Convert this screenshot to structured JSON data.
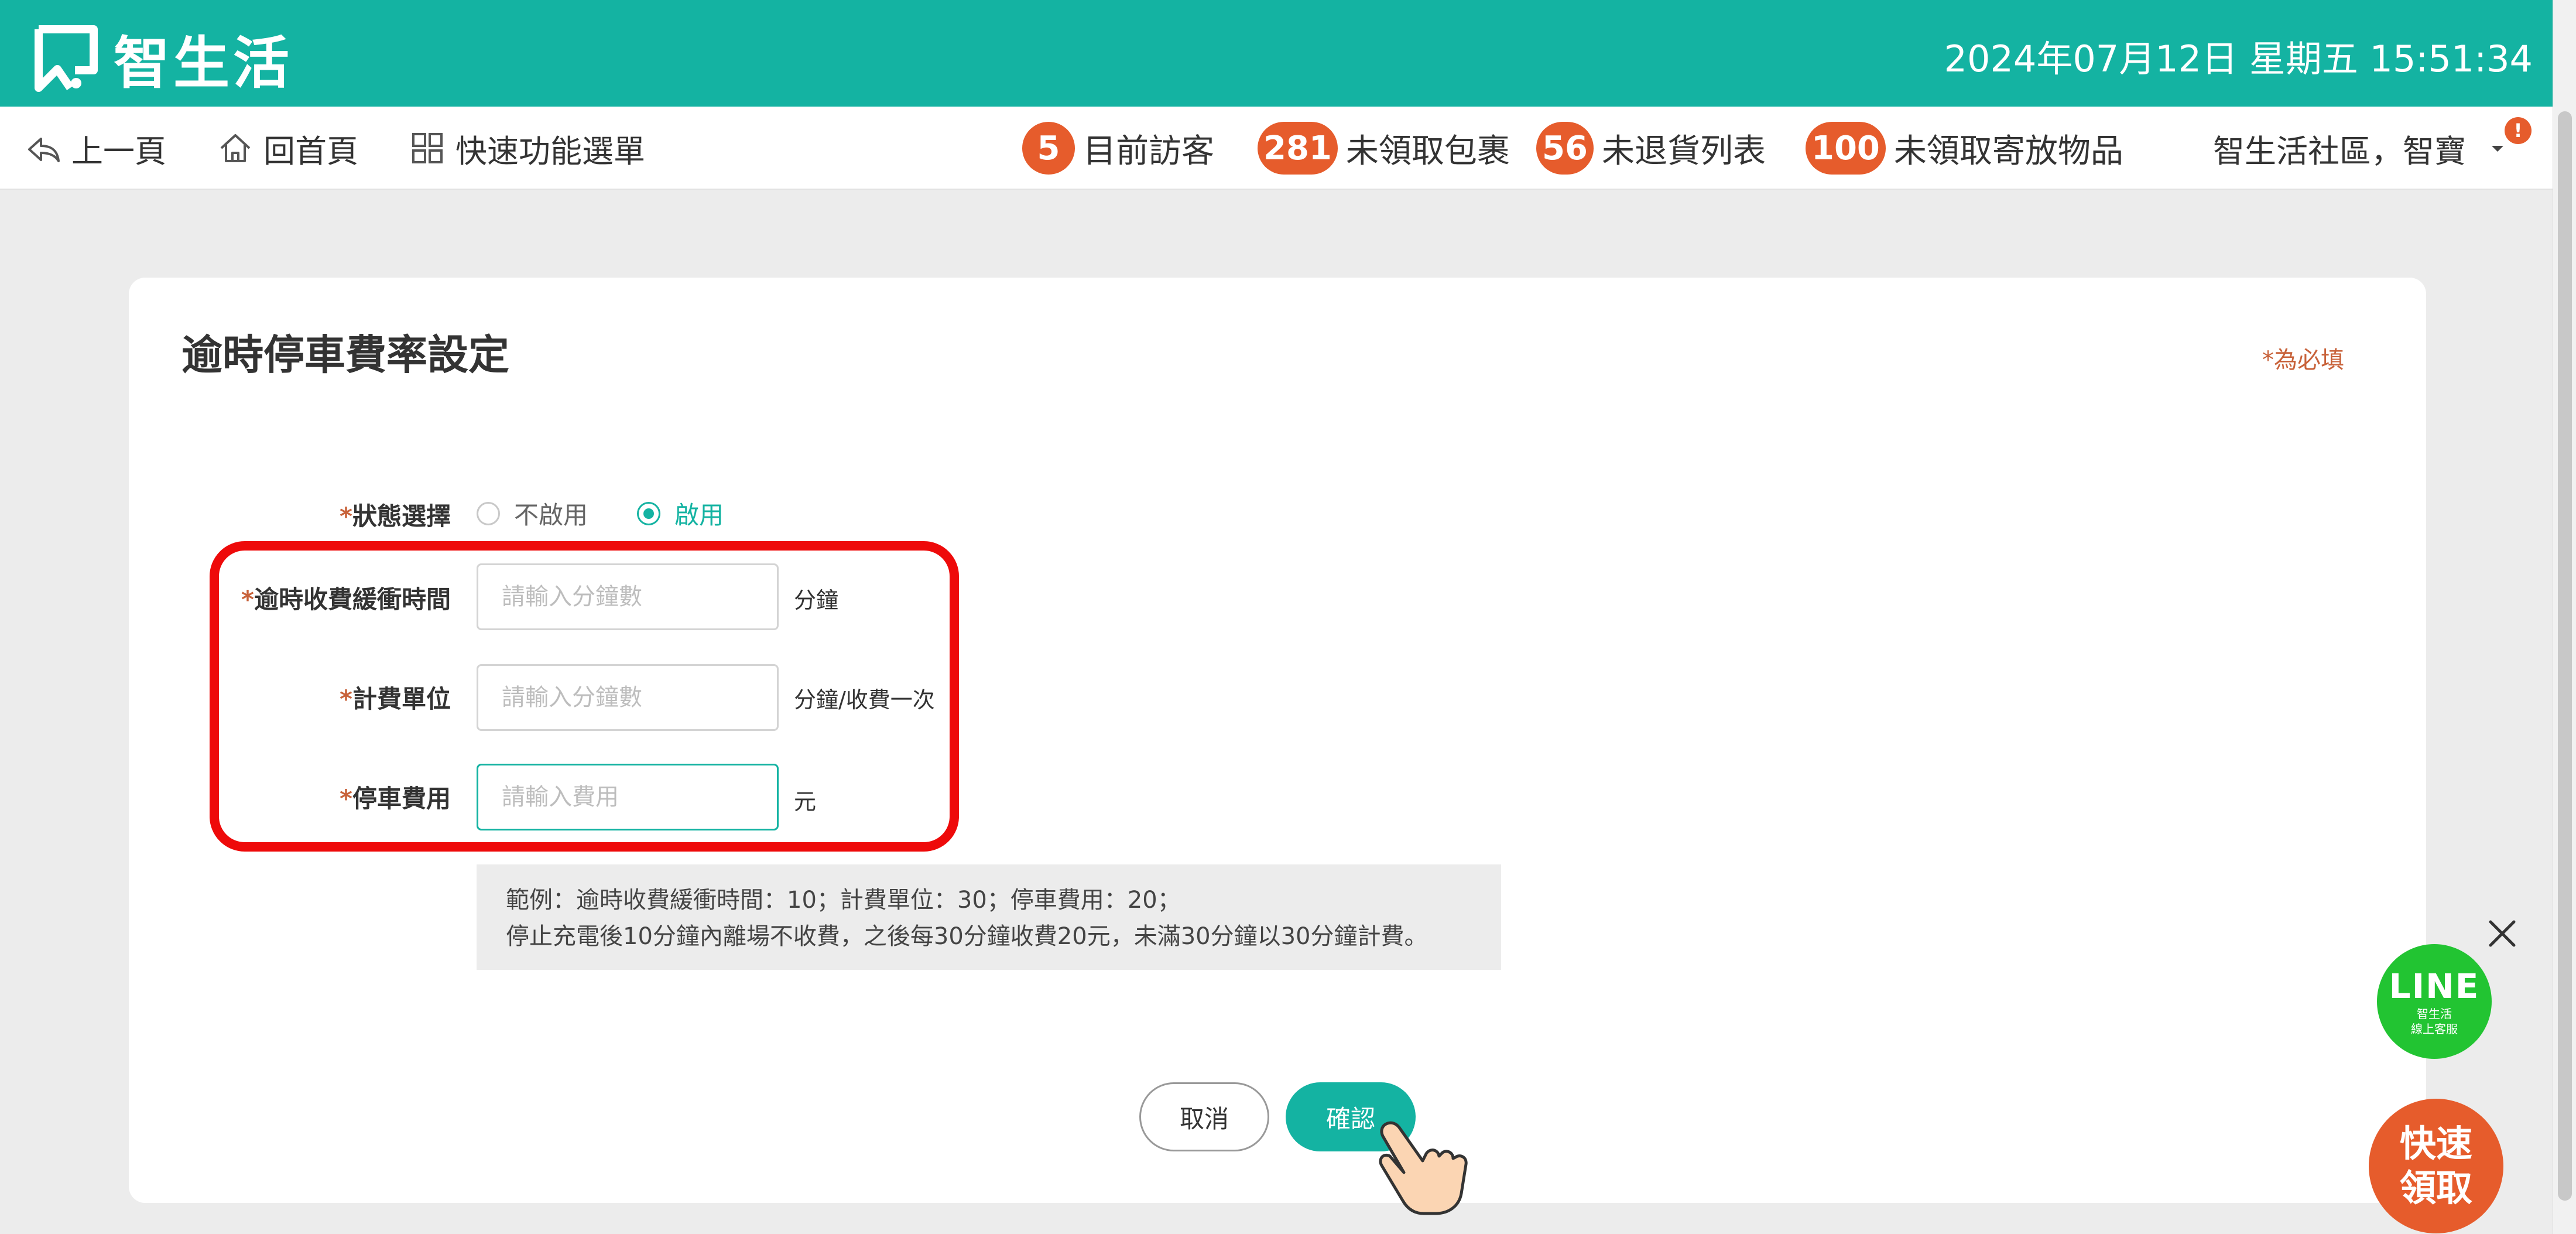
{
  "header": {
    "brand": "智生活",
    "datetime": "2024年07月12日 星期五 15:51:34"
  },
  "nav": {
    "back": "上一頁",
    "home": "回首頁",
    "quick_menu": "快速功能選單"
  },
  "stats": [
    {
      "count": "5",
      "label": "目前訪客"
    },
    {
      "count": "281",
      "label": "未領取包裹"
    },
    {
      "count": "56",
      "label": "未退貨列表"
    },
    {
      "count": "100",
      "label": "未領取寄放物品"
    }
  ],
  "user": {
    "name": "智生活社區，智寶",
    "alert": "!"
  },
  "form": {
    "title": "逾時停車費率設定",
    "required_note": "*為必填",
    "status": {
      "label": "狀態選擇",
      "options": [
        "不啟用",
        "啟用"
      ],
      "selected": "啟用"
    },
    "buffer": {
      "label": "逾時收費緩衝時間",
      "value": "",
      "placeholder": "請輸入分鐘數",
      "unit": "分鐘"
    },
    "billing_unit": {
      "label": "計費單位",
      "value": "",
      "placeholder": "請輸入分鐘數",
      "unit": "分鐘/收費一次"
    },
    "fee": {
      "label": "停車費用",
      "value": "",
      "placeholder": "請輸入費用",
      "unit": "元"
    },
    "example_line1": "範例：逾時收費緩衝時間：10；計費單位：30；停車費用：20；",
    "example_line2": "停止充電後10分鐘內離場不收費，之後每30分鐘收費20元，未滿30分鐘以30分鐘計費。",
    "cancel_label": "取消",
    "confirm_label": "確認"
  },
  "widgets": {
    "line_label": "LINE",
    "line_sub1": "智生活",
    "line_sub2": "線上客服",
    "quick_pickup": "快速領取"
  },
  "colors": {
    "brand": "#14b3a2",
    "accent": "#e65c2c",
    "highlight": "#ee0a0a",
    "line_green": "#22c432"
  }
}
